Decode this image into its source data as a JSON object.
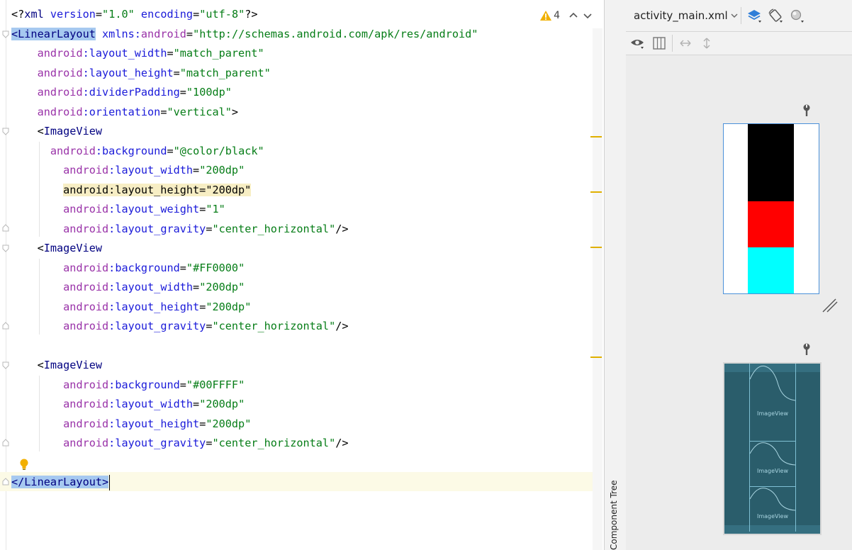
{
  "editor": {
    "warning_count": "4",
    "lines": [
      [
        [
          "pi",
          "<?"
        ],
        [
          "tag",
          "xml "
        ],
        [
          "attrns",
          "version"
        ],
        [
          "ht",
          "="
        ],
        [
          "val",
          "\"1.0\""
        ],
        [
          "ht",
          " "
        ],
        [
          "attrns",
          "encoding"
        ],
        [
          "ht",
          "="
        ],
        [
          "val",
          "\"utf-8\""
        ],
        [
          "pi",
          "?>"
        ]
      ],
      [
        [
          "tagsel",
          "<LinearLayout"
        ],
        [
          "ht",
          " "
        ],
        [
          "attrns",
          "xmlns:"
        ],
        [
          "attr",
          "android"
        ],
        [
          "ht",
          "="
        ],
        [
          "val",
          "\"http://schemas.android.com/apk/res/android\""
        ]
      ],
      [
        [
          "ht",
          "    "
        ],
        [
          "attr",
          "android"
        ],
        [
          "attrns",
          ":layout_width"
        ],
        [
          "ht",
          "="
        ],
        [
          "val",
          "\"match_parent\""
        ]
      ],
      [
        [
          "ht",
          "    "
        ],
        [
          "attr",
          "android"
        ],
        [
          "attrns",
          ":layout_height"
        ],
        [
          "ht",
          "="
        ],
        [
          "val",
          "\"match_parent\""
        ]
      ],
      [
        [
          "ht",
          "    "
        ],
        [
          "attr",
          "android"
        ],
        [
          "attrns",
          ":dividerPadding"
        ],
        [
          "ht",
          "="
        ],
        [
          "val",
          "\"100dp\""
        ]
      ],
      [
        [
          "ht",
          "    "
        ],
        [
          "attr",
          "android"
        ],
        [
          "attrns",
          ":orientation"
        ],
        [
          "ht",
          "="
        ],
        [
          "val",
          "\"vertical\""
        ],
        [
          "ht",
          ">"
        ]
      ],
      [
        [
          "ht",
          "    <"
        ],
        [
          "tag",
          "ImageView"
        ]
      ],
      [
        [
          "ht",
          "      "
        ],
        [
          "attr",
          "android"
        ],
        [
          "attrns",
          ":background"
        ],
        [
          "ht",
          "="
        ],
        [
          "val",
          "\"@color/black\""
        ]
      ],
      [
        [
          "ht",
          "        "
        ],
        [
          "attr",
          "android"
        ],
        [
          "attrns",
          ":layout_width"
        ],
        [
          "ht",
          "="
        ],
        [
          "val",
          "\"200dp\""
        ]
      ],
      [
        [
          "ht",
          "        "
        ],
        [
          "match",
          "android:layout_height=\"200dp\""
        ]
      ],
      [
        [
          "ht",
          "        "
        ],
        [
          "attr",
          "android"
        ],
        [
          "attrns",
          ":layout_weight"
        ],
        [
          "ht",
          "="
        ],
        [
          "val",
          "\"1\""
        ]
      ],
      [
        [
          "ht",
          "        "
        ],
        [
          "attr",
          "android"
        ],
        [
          "attrns",
          ":layout_gravity"
        ],
        [
          "ht",
          "="
        ],
        [
          "val",
          "\"center_horizontal\""
        ],
        [
          "ht",
          "/>"
        ]
      ],
      [
        [
          "ht",
          "    <"
        ],
        [
          "tag",
          "ImageView"
        ]
      ],
      [
        [
          "ht",
          "        "
        ],
        [
          "attr",
          "android"
        ],
        [
          "attrns",
          ":background"
        ],
        [
          "ht",
          "="
        ],
        [
          "val",
          "\"#FF0000\""
        ]
      ],
      [
        [
          "ht",
          "        "
        ],
        [
          "attr",
          "android"
        ],
        [
          "attrns",
          ":layout_width"
        ],
        [
          "ht",
          "="
        ],
        [
          "val",
          "\"200dp\""
        ]
      ],
      [
        [
          "ht",
          "        "
        ],
        [
          "attr",
          "android"
        ],
        [
          "attrns",
          ":layout_height"
        ],
        [
          "ht",
          "="
        ],
        [
          "val",
          "\"200dp\""
        ]
      ],
      [
        [
          "ht",
          "        "
        ],
        [
          "attr",
          "android"
        ],
        [
          "attrns",
          ":layout_gravity"
        ],
        [
          "ht",
          "="
        ],
        [
          "val",
          "\"center_horizontal\""
        ],
        [
          "ht",
          "/>"
        ]
      ],
      [],
      [
        [
          "ht",
          "    <"
        ],
        [
          "tag",
          "ImageView"
        ]
      ],
      [
        [
          "ht",
          "        "
        ],
        [
          "attr",
          "android"
        ],
        [
          "attrns",
          ":background"
        ],
        [
          "ht",
          "="
        ],
        [
          "val",
          "\"#00FFFF\""
        ]
      ],
      [
        [
          "ht",
          "        "
        ],
        [
          "attr",
          "android"
        ],
        [
          "attrns",
          ":layout_width"
        ],
        [
          "ht",
          "="
        ],
        [
          "val",
          "\"200dp\""
        ]
      ],
      [
        [
          "ht",
          "        "
        ],
        [
          "attr",
          "android"
        ],
        [
          "attrns",
          ":layout_height"
        ],
        [
          "ht",
          "="
        ],
        [
          "val",
          "\"200dp\""
        ]
      ],
      [
        [
          "ht",
          "        "
        ],
        [
          "attr",
          "android"
        ],
        [
          "attrns",
          ":layout_gravity"
        ],
        [
          "ht",
          "="
        ],
        [
          "val",
          "\"center_horizontal\""
        ],
        [
          "ht",
          "/>"
        ]
      ],
      [],
      [
        [
          "tagsel",
          "</LinearLayout>"
        ]
      ]
    ]
  },
  "tool_window": {
    "component_tree_label": "Component Tree"
  },
  "design_panel": {
    "file_tab": "activity_main.xml",
    "preview_colors": [
      "#000000",
      "#ff0000",
      "#00ffff"
    ],
    "blueprint_labels": [
      "ImageView",
      "ImageView",
      "ImageView"
    ]
  }
}
